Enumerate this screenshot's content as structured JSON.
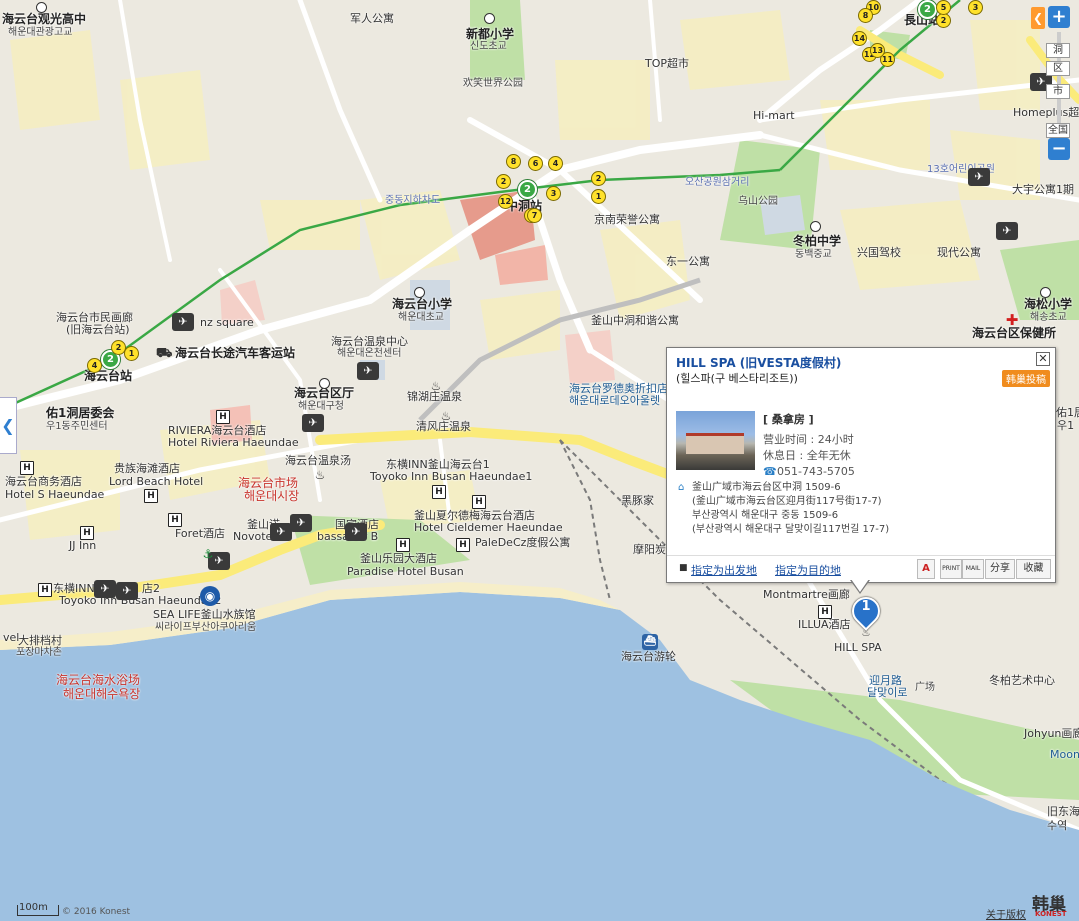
{
  "map": {
    "labels": [
      {
        "t": "海云台观光高中",
        "c": "bold"
      },
      {
        "t": "해운대관광고교",
        "c": "sm"
      },
      {
        "t": "军人公寓",
        "c": ""
      },
      {
        "t": "新都小学",
        "c": "bold"
      },
      {
        "t": "신도초교",
        "c": "sm"
      },
      {
        "t": "欢笑世界公园",
        "c": "sm"
      },
      {
        "t": "TOP超市",
        "c": ""
      },
      {
        "t": "長山站",
        "c": "bold"
      },
      {
        "t": "Hi-mart",
        "c": ""
      },
      {
        "t": "Homeplus超",
        "c": ""
      },
      {
        "t": "13호어린이공원",
        "c": "road"
      },
      {
        "t": "大宇公寓1期",
        "c": ""
      },
      {
        "t": "중동지하차도",
        "c": "road"
      },
      {
        "t": "오산공원삼거리",
        "c": "road"
      },
      {
        "t": "中洞站",
        "c": "bold"
      },
      {
        "t": "京南荣誉公寓",
        "c": ""
      },
      {
        "t": "乌山公园",
        "c": "sm"
      },
      {
        "t": "冬柏中学",
        "c": "bold"
      },
      {
        "t": "동백중교",
        "c": "sm"
      },
      {
        "t": "兴国驾校",
        "c": ""
      },
      {
        "t": "现代公寓",
        "c": ""
      },
      {
        "t": "东一公寓",
        "c": ""
      },
      {
        "t": "海松小学",
        "c": "bold"
      },
      {
        "t": "해송초교",
        "c": "sm"
      },
      {
        "t": "海云台区保健所",
        "c": "bold"
      },
      {
        "t": "海云台市民画廊",
        "c": ""
      },
      {
        "t": "(旧海云台站)",
        "c": ""
      },
      {
        "t": "nz square",
        "c": ""
      },
      {
        "t": "海云台小学",
        "c": "bold"
      },
      {
        "t": "해운대초교",
        "c": "sm"
      },
      {
        "t": "海云台温泉中心",
        "c": ""
      },
      {
        "t": "해운대온천센터",
        "c": "sm"
      },
      {
        "t": "釜山中洞和谐公寓",
        "c": ""
      },
      {
        "t": "海云台长途汽车客运站",
        "c": "bold"
      },
      {
        "t": "海云台站",
        "c": "bold"
      },
      {
        "t": "海云台区厅",
        "c": "bold"
      },
      {
        "t": "해운대구청",
        "c": "sm"
      },
      {
        "t": "锦湖庄温泉",
        "c": ""
      },
      {
        "t": "海云台罗德奥折扣店",
        "c": "sea"
      },
      {
        "t": "해운대로데오아울렛",
        "c": "sea"
      },
      {
        "t": "佑1洞居委会",
        "c": "bold"
      },
      {
        "t": "우1동주민센터",
        "c": "sm"
      },
      {
        "t": "RIVIERA海云台酒店",
        "c": ""
      },
      {
        "t": "Hotel Riviera Haeundae",
        "c": ""
      },
      {
        "t": "清风庄温泉",
        "c": ""
      },
      {
        "t": "海云台温泉汤",
        "c": ""
      },
      {
        "t": "东横INN釜山海云台1",
        "c": ""
      },
      {
        "t": "Toyoko Inn Busan Haeundae1",
        "c": ""
      },
      {
        "t": "海云台商务酒店",
        "c": ""
      },
      {
        "t": "Hotel S Haeundae",
        "c": ""
      },
      {
        "t": "贵族海滩酒店",
        "c": ""
      },
      {
        "t": "Lord Beach Hotel",
        "c": ""
      },
      {
        "t": "海云台市场",
        "c": "red"
      },
      {
        "t": "해운대시장",
        "c": "red"
      },
      {
        "t": "黑豚家",
        "c": ""
      },
      {
        "t": "Foret酒店",
        "c": ""
      },
      {
        "t": "釜山夏尔德梅海云台酒店",
        "c": ""
      },
      {
        "t": "Hotel Cieldemer Haeundae",
        "c": ""
      },
      {
        "t": "釜山诺",
        "c": ""
      },
      {
        "t": "国宾酒店",
        "c": ""
      },
      {
        "t": "Novotel",
        "c": ""
      },
      {
        "t": "bassador B",
        "c": ""
      },
      {
        "t": "JJ Inn",
        "c": ""
      },
      {
        "t": "PaleDeCz度假公寓",
        "c": ""
      },
      {
        "t": "釜山乐园大酒店",
        "c": ""
      },
      {
        "t": "Paradise Hotel Busan",
        "c": ""
      },
      {
        "t": "摩阳炭",
        "c": ""
      },
      {
        "t": "东横INN",
        "c": ""
      },
      {
        "t": "店2",
        "c": ""
      },
      {
        "t": "Toyoko Inn Busan Haeundae2",
        "c": ""
      },
      {
        "t": "SEA LIFE釜山水族馆",
        "c": ""
      },
      {
        "t": "씨라이프부산아쿠아리움",
        "c": "sm"
      },
      {
        "t": "Montmartre画廊",
        "c": ""
      },
      {
        "t": "ILLUA酒店",
        "c": ""
      },
      {
        "t": "HILL SPA",
        "c": ""
      },
      {
        "t": "海云台游轮",
        "c": ""
      },
      {
        "t": "大排档村",
        "c": ""
      },
      {
        "t": "포장마차촌",
        "c": "sm"
      },
      {
        "t": "海云台海水浴场",
        "c": "red"
      },
      {
        "t": "해운대해수욕장",
        "c": "red"
      },
      {
        "t": "迎月路",
        "c": "sea"
      },
      {
        "t": "달맞이로",
        "c": "sea"
      },
      {
        "t": "广场",
        "c": "sm"
      },
      {
        "t": "冬柏艺术中心",
        "c": ""
      },
      {
        "t": "Johyun画廊",
        "c": ""
      },
      {
        "t": "Moon",
        "c": "sea"
      },
      {
        "t": "旧东海",
        "c": ""
      },
      {
        "t": "수역",
        "c": ""
      },
      {
        "t": "vel",
        "c": ""
      },
      {
        "t": "佑1居",
        "c": ""
      },
      {
        "t": "우1",
        "c": ""
      }
    ],
    "stations": [
      "10",
      "8",
      "2",
      "5",
      "3",
      "14",
      "12",
      "11",
      "13",
      "8",
      "6",
      "4",
      "2",
      "12",
      "9",
      "2",
      "3",
      "1",
      "7",
      "2",
      "4",
      "1"
    ],
    "zoom": {
      "plus": "+",
      "minus": "−",
      "ticks": [
        "洞",
        "区",
        "市",
        "全国"
      ]
    },
    "collapse_left": "❮",
    "collapse_right": "❮"
  },
  "popup": {
    "title": "HILL SPA (旧VESTA度假村)",
    "subtitle": "(힐스파(구 베스타리조트))",
    "report": "韩巢投稿",
    "category": "[ 桑拿房 ]",
    "hours": "营业时间 : 24小时",
    "closed": "休息日 : 全年无休",
    "phone": "051-743-5705",
    "address_lines": [
      "釜山广域市海云台区中洞 1509-6",
      "(釜山广域市海云台区迎月街117号街17-7)",
      "부산광역시 해운대구 중동 1509-6",
      "(부산광역시 해운대구 달맞이길117번길 17-7)"
    ],
    "set_start": "指定为出发地",
    "set_dest": "指定为目的地",
    "btn_a": "A",
    "btn_print": "PRINT",
    "btn_mail": "MAIL",
    "btn_share": "分享",
    "btn_fav": "收藏",
    "close": "✕"
  },
  "marker": {
    "number": "1"
  },
  "footer": {
    "scale": "100m",
    "copyright": "© 2016 Konest",
    "terms": "关于版权",
    "brand": "韩巢",
    "brand_sub": "KONEST"
  }
}
